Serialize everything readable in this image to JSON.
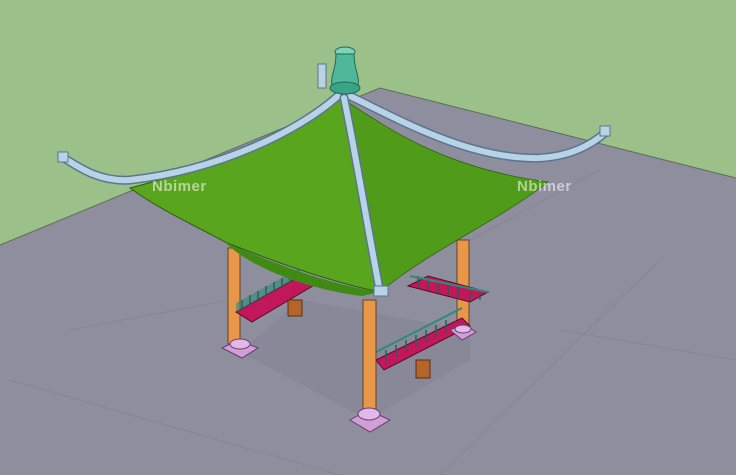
{
  "scene": {
    "subject": "pavilion-model",
    "colors": {
      "sky": "#9cc08a",
      "ground": "#8f8e9e",
      "roof": "#5aa51e",
      "roof_shadow": "#3f8a14",
      "ridge": "#b8d2e6",
      "finial": "#4fb89a",
      "column": "#e8974a",
      "base": "#cf9fd6",
      "railing_frame": "#c2185b",
      "railing_bars": "#2e8b7a",
      "bench_leg": "#b5652a"
    }
  },
  "watermarks": [
    {
      "text": "Nbimer"
    },
    {
      "text": "Nbimer"
    }
  ]
}
